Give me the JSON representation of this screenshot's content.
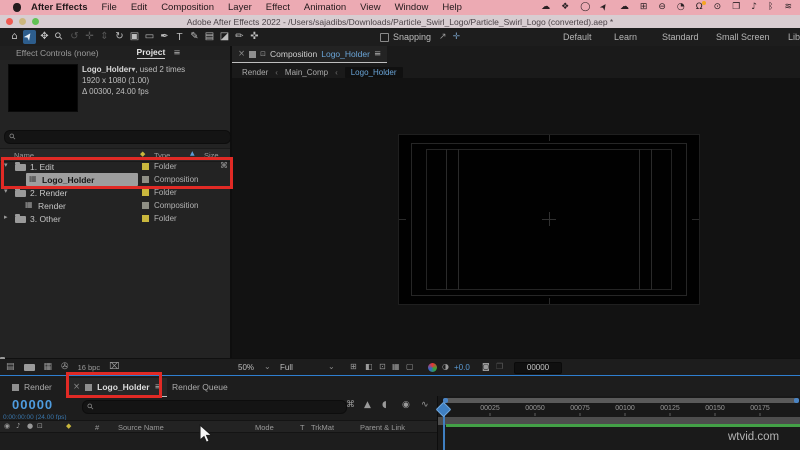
{
  "menubar": {
    "items": [
      "After Effects",
      "File",
      "Edit",
      "Composition",
      "Layer",
      "Effect",
      "Animation",
      "View",
      "Window",
      "Help"
    ],
    "status_icons": [
      {
        "name": "sync-cloud",
        "glyph": "☁"
      },
      {
        "name": "dropbox",
        "glyph": "❖"
      },
      {
        "name": "obs",
        "glyph": "◯"
      },
      {
        "name": "cursor",
        "glyph": "➤"
      },
      {
        "name": "creative-cloud",
        "glyph": "☁"
      },
      {
        "name": "docker",
        "glyph": "⊞"
      },
      {
        "name": "info",
        "glyph": "⊖"
      },
      {
        "name": "clock",
        "glyph": "◔"
      },
      {
        "name": "notifications",
        "glyph": "Ω"
      },
      {
        "name": "screen-record",
        "glyph": "⊙"
      },
      {
        "name": "window-stack",
        "glyph": "❐"
      },
      {
        "name": "volume",
        "glyph": "♪"
      },
      {
        "name": "bluetooth",
        "glyph": "ᛒ"
      },
      {
        "name": "wifi",
        "glyph": "≋"
      }
    ]
  },
  "titlebar": {
    "title": "Adobe After Effects 2022 - /Users/sajadibs/Downloads/Particle_Swirl_Logo/Particle_Swirl_Logo (converted).aep *"
  },
  "toolbar": {
    "tools": [
      {
        "name": "home-tool",
        "glyph": "⌂"
      },
      {
        "name": "selection-tool",
        "glyph": "➤"
      },
      {
        "name": "hand-tool",
        "glyph": "✥"
      },
      {
        "name": "zoom-tool",
        "glyph": "⚲"
      },
      {
        "name": "orbit-camera-tool",
        "glyph": "↺"
      },
      {
        "name": "pan-camera-tool",
        "glyph": "✛"
      },
      {
        "name": "dolly-camera-tool",
        "glyph": "⇕"
      },
      {
        "name": "rotation-tool",
        "glyph": "↻"
      },
      {
        "name": "pan-behind-tool",
        "glyph": "▣"
      },
      {
        "name": "shape-tool",
        "glyph": "▭"
      },
      {
        "name": "pen-tool",
        "glyph": "✒"
      },
      {
        "name": "type-tool",
        "glyph": "T"
      },
      {
        "name": "brush-tool",
        "glyph": "✎"
      },
      {
        "name": "clone-stamp-tool",
        "glyph": "▤"
      },
      {
        "name": "eraser-tool",
        "glyph": "◪"
      },
      {
        "name": "roto-brush-tool",
        "glyph": "✏"
      },
      {
        "name": "puppet-pin-tool",
        "glyph": "✜"
      }
    ],
    "snapping_label": "Snapping",
    "snap_icons": [
      {
        "name": "snap-angle",
        "glyph": "↗"
      },
      {
        "name": "snap-grid",
        "glyph": "✛"
      }
    ],
    "workspaces": [
      "Default",
      "Learn",
      "Standard",
      "Small Screen",
      "Lib"
    ]
  },
  "project_panel": {
    "tab_effect_controls": "Effect Controls (none)",
    "tab_project": "Project",
    "info": {
      "name": "Logo_Holder",
      "usage": ", used 2 times",
      "dimensions": "1920 x 1080 (1.00)",
      "duration": "Δ 00300, 24.00 fps"
    },
    "columns": {
      "name": "Name",
      "type": "Type",
      "size": "Size"
    },
    "rows": [
      {
        "name": "1. Edit",
        "type": "Folder"
      },
      {
        "name": "Logo_Holder",
        "type": "Composition"
      },
      {
        "name": "2. Render",
        "type": "Folder"
      },
      {
        "name": "Render",
        "type": "Composition"
      },
      {
        "name": "3. Other",
        "type": "Folder"
      }
    ],
    "footer": {
      "bit_depth": "16 bpc"
    }
  },
  "comp_panel": {
    "tab_label": "Composition",
    "tab_comp_name": "Logo_Holder",
    "breadcrumb": [
      "Render",
      "Main_Comp",
      "Logo_Holder"
    ],
    "bottom": {
      "zoom": "50%",
      "resolution": "Full",
      "exposure": "+0.0",
      "timecode": "00000"
    }
  },
  "timeline": {
    "tabs": [
      "Render",
      "Logo_Holder",
      "Render Queue"
    ],
    "timecode_frames": "00000",
    "timecode_detail": "0:00:00:00 (24.00 fps)",
    "columns": {
      "hash": "#",
      "source": "Source Name",
      "mode": "Mode",
      "t": "T",
      "trkmat": "TrkMat",
      "parent": "Parent & Link"
    },
    "ruler_labels": [
      "00025",
      "00050",
      "00075",
      "00100",
      "00125",
      "00150",
      "00175"
    ]
  },
  "watermark": "wtvid.com",
  "icons": {
    "close": "×",
    "menu": "≡",
    "chevron_down": "▾",
    "chevron_right": "▸",
    "chevron_small": "⌄",
    "crumb_sep": "‹",
    "search": "⚲",
    "label": "◆",
    "sort_up": "▲",
    "lock": "⊡",
    "usage": "⌘",
    "eye": "◉",
    "audio": "♪",
    "solo": "●",
    "lock_col": "⊡",
    "flowchart": "⌘",
    "draft3d": "▲",
    "shy": "◖",
    "motion_blur": "◉",
    "graph": "∿",
    "grid": "⊞",
    "mask": "◧",
    "roi": "⊡",
    "transparency": "▦",
    "view_extra": "▢",
    "exposure": "◑",
    "camera": "◙",
    "snapshot": "❐",
    "import": "▤",
    "new_comp": "▦",
    "settings": "✇",
    "trash": "⌧"
  },
  "colors": {
    "annotation_red": "#e12a25",
    "accent_blue": "#4e9cdf",
    "menubar_pink": "#ecaab3",
    "workarea_green": "#43a047",
    "folder_label_yellow": "#c9b73d",
    "selection_gray": "#9e9e9e"
  }
}
